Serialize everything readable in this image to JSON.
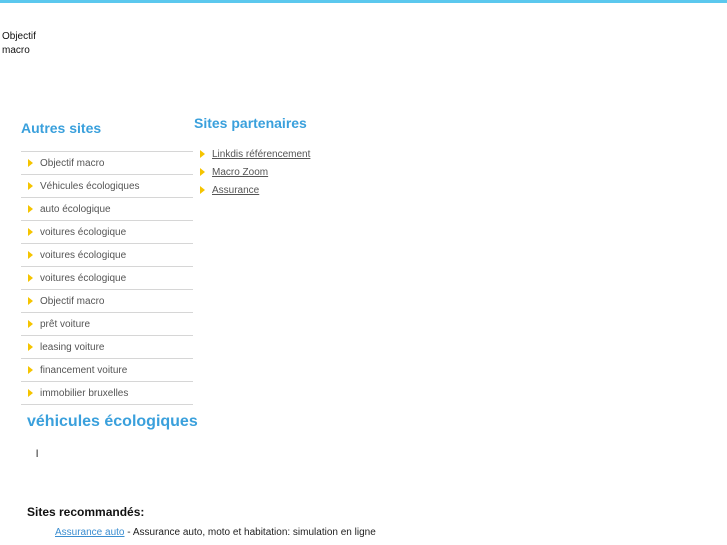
{
  "header": {
    "logo_text": "Objectif macro"
  },
  "autres_sites": {
    "title": "Autres sites",
    "items": [
      "Objectif macro",
      "Véhicules écologiques",
      "auto écologique",
      "voitures écologique",
      "voitures écologique",
      "voitures écologique",
      "Objectif macro",
      "prêt voiture",
      "leasing voiture",
      "financement voiture",
      "immobilier bruxelles"
    ]
  },
  "sites_partenaires": {
    "title": "Sites partenaires",
    "items": [
      "Linkdis référencement",
      "Macro Zoom",
      "Assurance"
    ]
  },
  "main": {
    "title": "véhicules écologiques",
    "body": "l"
  },
  "recommandes": {
    "title": "Sites recommandés:",
    "link": "Assurance auto",
    "description": " - Assurance auto, moto et habitation: simulation en ligne"
  },
  "colors": {
    "accent": "#3aa0dc",
    "top_bar": "#5bc8ee",
    "arrow": "#f5c400"
  },
  "icons": {
    "bullet": "arrow-right-icon"
  }
}
